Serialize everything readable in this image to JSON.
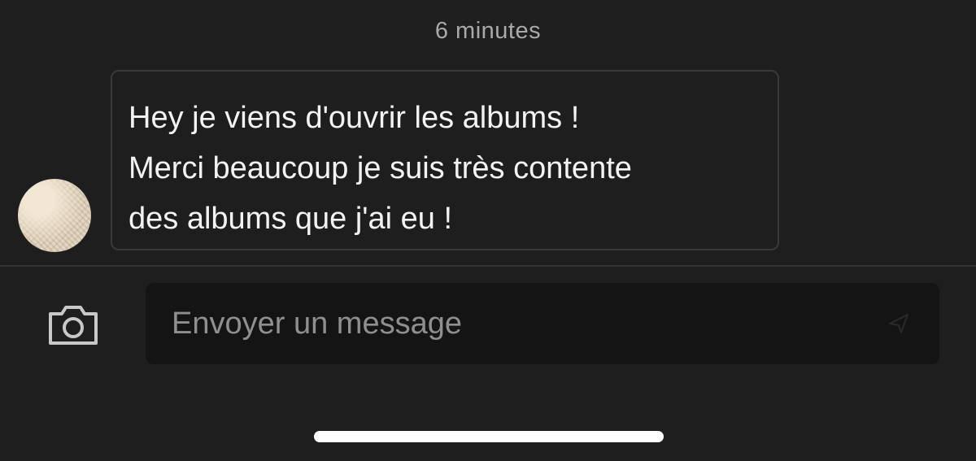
{
  "conversation": {
    "timestamp": "6 minutes",
    "message": {
      "lines": [
        "Hey je viens d'ouvrir les albums !",
        "Merci beaucoup je suis très contente",
        "des albums que j'ai eu !"
      ]
    },
    "avatar_icon": "user-avatar"
  },
  "composer": {
    "placeholder": "Envoyer un message",
    "value": "",
    "camera_icon": "camera-icon",
    "send_icon": "send-icon"
  },
  "colors": {
    "background": "#1e1e1e",
    "bubble_border": "#393939",
    "input_background": "#141414",
    "muted_text": "#a9a9a9",
    "home_indicator": "#ffffff"
  }
}
